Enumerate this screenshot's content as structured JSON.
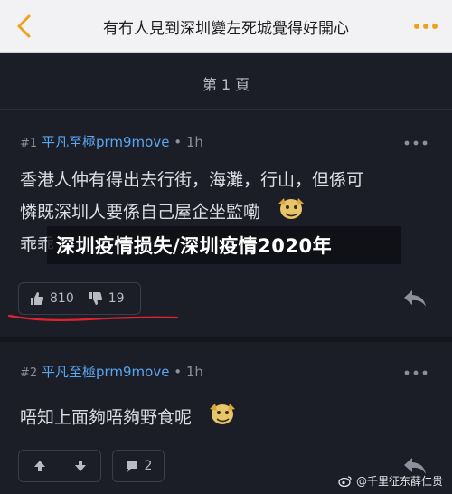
{
  "header": {
    "title": "有冇人見到深圳變左死城覺得好開心"
  },
  "page_indicator": "第 1 頁",
  "posts": [
    {
      "number": "#1",
      "username": "平凡至極prm9move",
      "time": "1h",
      "text_line1": "香港人仲有得出去行街，海灘，行山，但係可",
      "text_line2": "憐既深圳人要係自己屋企坐監嘞",
      "text_line3": "乖乖",
      "upvotes": "810",
      "downvotes": "19"
    },
    {
      "number": "#2",
      "username": "平凡至極prm9move",
      "time": "1h",
      "text": "唔知上面夠唔夠野食呢",
      "replies": "2"
    }
  ],
  "overlay": {
    "text": "深圳疫情损失/深圳疫情2020年"
  },
  "watermark": {
    "text": "@千里征东薛仁贵"
  },
  "colors": {
    "username": "#5aa6ef",
    "background": "#1b1d27",
    "header_bg": "#f2f2f4",
    "mark": "#e0232e"
  }
}
